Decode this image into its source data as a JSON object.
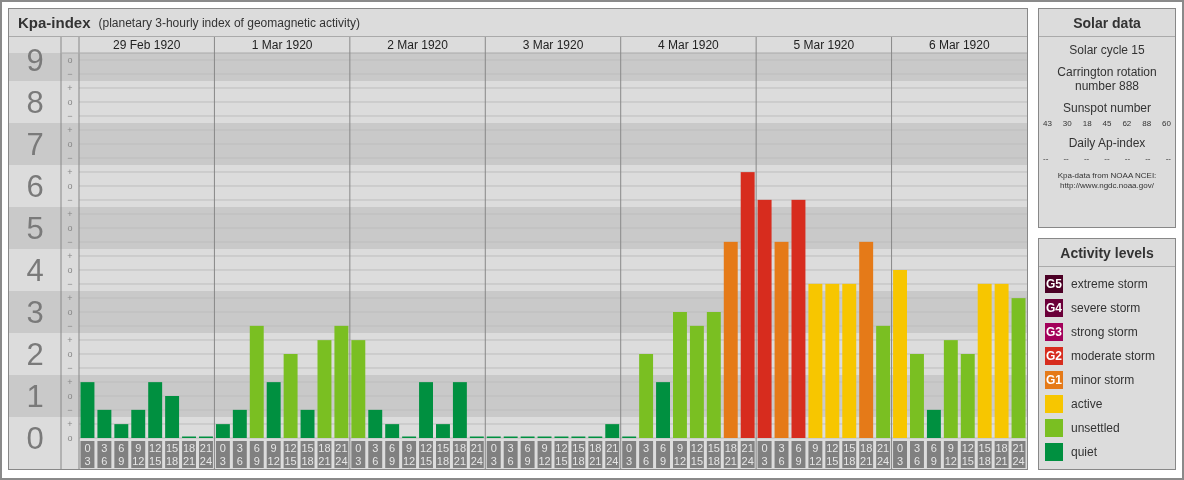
{
  "chart_panel": {
    "title": "Kpa-index",
    "subtitle": "(planetary 3-hourly index of geomagnetic activity)",
    "dates": [
      "29 Feb 1920",
      "1 Mar 1920",
      "2 Mar 1920",
      "3 Mar 1920",
      "4 Mar 1920",
      "5 Mar 1920",
      "6 Mar 1920"
    ],
    "minor_tick_labels": [
      "o",
      "−",
      "+",
      "o",
      "−",
      "+",
      "o",
      "−",
      "+",
      "o",
      "−",
      "+",
      "o",
      "−",
      "+",
      "o",
      "−",
      "+",
      "o",
      "−",
      "+",
      "o",
      "−",
      "+",
      "o",
      "−",
      "+",
      "o"
    ],
    "chart_data": {
      "type": "bar",
      "ylim": [
        0,
        9
      ],
      "grid": true,
      "categories": [
        "0\n3",
        "3\n6",
        "6\n9",
        "9\n12",
        "12\n15",
        "15\n18",
        "18\n21",
        "21\n24",
        "0\n3",
        "3\n6",
        "6\n9",
        "9\n12",
        "12\n15",
        "15\n18",
        "18\n21",
        "21\n24",
        "0\n3",
        "3\n6",
        "6\n9",
        "9\n12",
        "12\n15",
        "15\n18",
        "18\n21",
        "21\n24",
        "0\n3",
        "3\n6",
        "6\n9",
        "9\n12",
        "12\n15",
        "15\n18",
        "18\n21",
        "21\n24",
        "0\n3",
        "3\n6",
        "6\n9",
        "9\n12",
        "12\n15",
        "15\n18",
        "18\n21",
        "21\n24",
        "0\n3",
        "3\n6",
        "6\n9",
        "9\n12",
        "12\n15",
        "15\n18",
        "18\n21",
        "21\n24",
        "0\n3",
        "3\n6",
        "6\n9",
        "9\n12",
        "12\n15",
        "15\n18",
        "18\n21",
        "21\n24"
      ],
      "series": [
        {
          "values": [
            1.33,
            0.67,
            0.33,
            0.67,
            1.33,
            1,
            0,
            0,
            0.33,
            0.67,
            2.67,
            1.33,
            2,
            0.67,
            2.33,
            2.67,
            2.33,
            0.67,
            0.33,
            0,
            1.33,
            0.33,
            1.33,
            0,
            0,
            0,
            0,
            0,
            0,
            0,
            0,
            0.33,
            0,
            2,
            1.33,
            3,
            2.67,
            3,
            4.67,
            6.33,
            5.67,
            4.67,
            5.67,
            3.67,
            3.67,
            3.67,
            4.67,
            2.67,
            4,
            2,
            0.67,
            2.33,
            2,
            3.67,
            3.67,
            3.33
          ]
        }
      ],
      "yticks": [
        {
          "value": 0,
          "label": "0"
        },
        {
          "value": 1,
          "label": "1"
        },
        {
          "value": 2,
          "label": "2"
        },
        {
          "value": 3,
          "label": "3"
        },
        {
          "value": 4,
          "label": "4"
        },
        {
          "value": 5,
          "label": "5"
        },
        {
          "value": 6,
          "label": "6"
        },
        {
          "value": 7,
          "label": "7"
        },
        {
          "value": 8,
          "label": "8"
        },
        {
          "value": 9,
          "label": "9"
        }
      ]
    }
  },
  "solar_data": {
    "title": "Solar data",
    "solar_cycle": "Solar cycle 15",
    "carrington_rotation": "Carrington rotation number 888",
    "sunspot_label": "Sunspot number",
    "sunspot_numbers": [
      "43",
      "30",
      "18",
      "45",
      "62",
      "88",
      "60"
    ],
    "ap_label": "Daily Ap-index",
    "ap_values": [
      "--",
      "--",
      "--",
      "--",
      "--",
      "--",
      "--"
    ],
    "source": "Kpa-data from NOAA NCEI:",
    "source_url": "http://www.ngdc.noaa.gov/"
  },
  "legend": {
    "title": "Activity levels",
    "items": [
      {
        "badge": "G5",
        "label": "extreme storm",
        "color": "#4b0025"
      },
      {
        "badge": "G4",
        "label": "severe storm",
        "color": "#6b0039"
      },
      {
        "badge": "G3",
        "label": "strong storm",
        "color": "#a3005a"
      },
      {
        "badge": "G2",
        "label": "moderate storm",
        "color": "#d72c1e"
      },
      {
        "badge": "G1",
        "label": "minor storm",
        "color": "#e57a18"
      },
      {
        "label": "active",
        "color": "#f7c600"
      },
      {
        "label": "unsettled",
        "color": "#7abf22"
      },
      {
        "label": "quiet",
        "color": "#009040"
      }
    ]
  }
}
